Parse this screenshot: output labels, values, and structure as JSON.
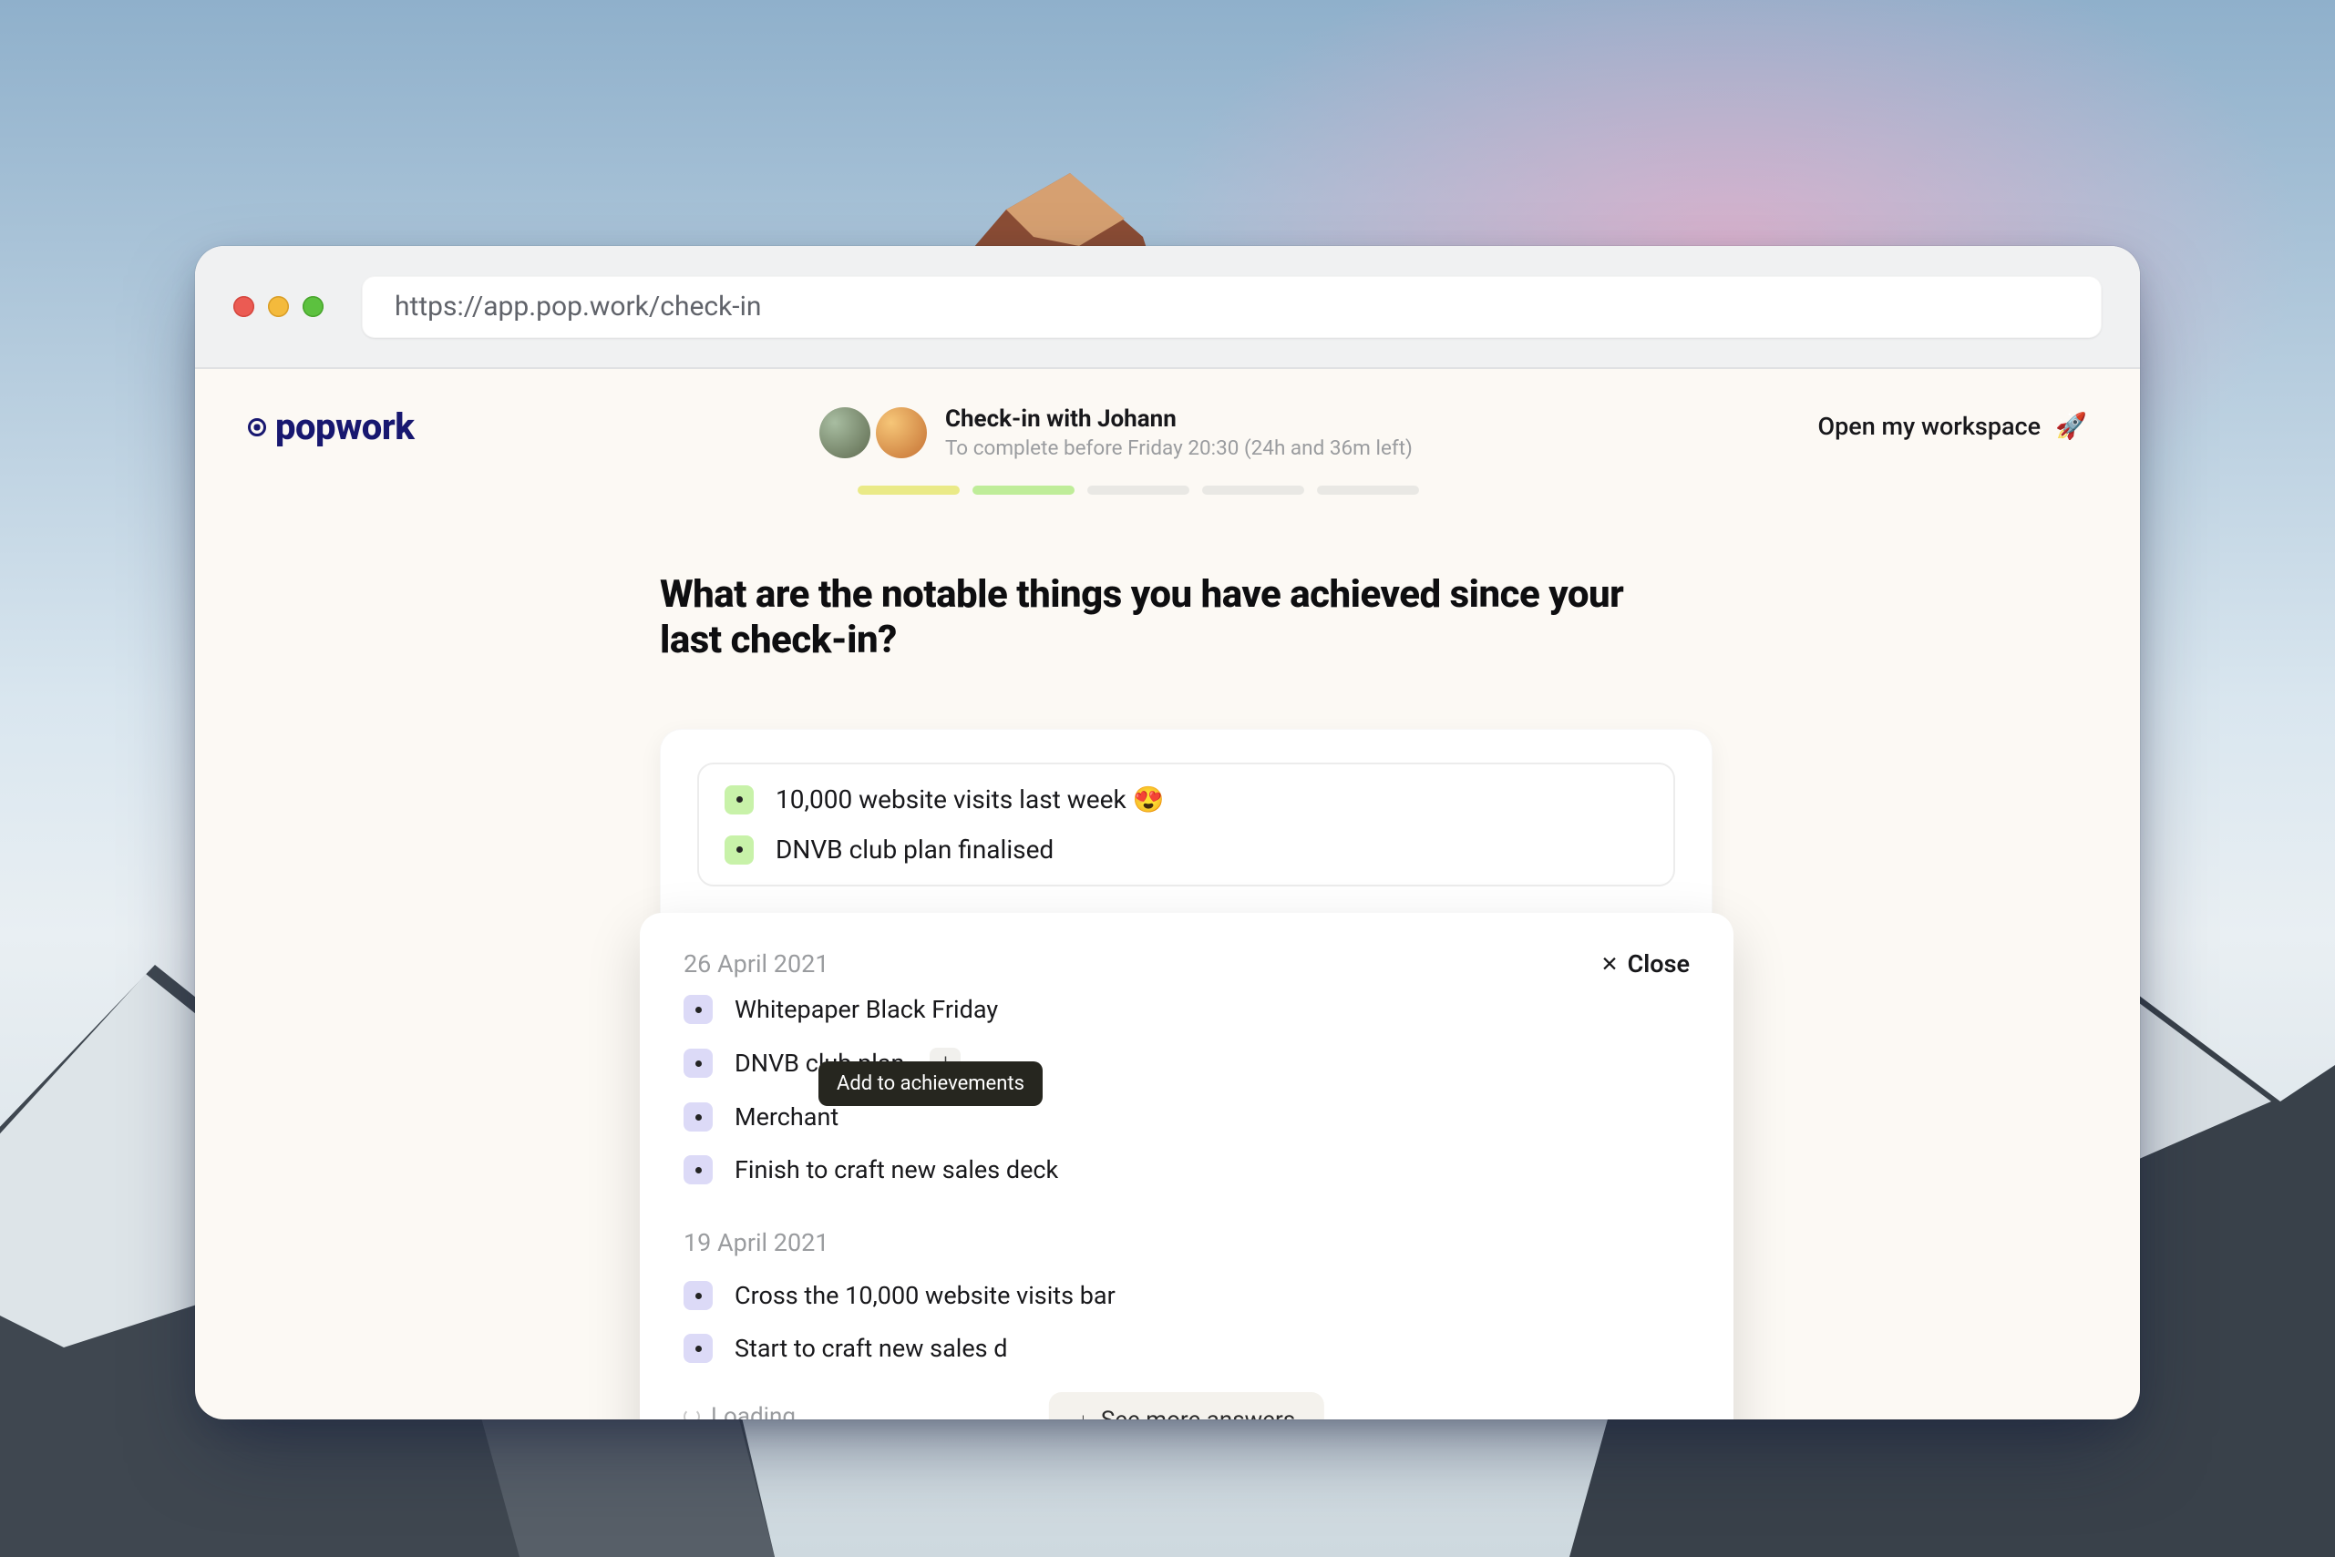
{
  "browser": {
    "url": "https://app.pop.work/check-in"
  },
  "header": {
    "logo": "popwork",
    "title": "Check-in with Johann",
    "deadline": "To complete before Friday 20:30 (24h and 36m left)",
    "workspace_link": "Open my workspace",
    "workspace_icon": "🚀"
  },
  "question": "What are the notable things you have achieved since your last check-in?",
  "current_answers": [
    "10,000 website visits last week 😍",
    "DNVB club plan finalised"
  ],
  "history": {
    "close_label": "Close",
    "tooltip": "Add to achievements",
    "see_more_label": "See more answers",
    "loading_label": "Loading...",
    "groups": [
      {
        "date": "26 April 2021",
        "items": [
          {
            "text": "Whitepaper Black Friday"
          },
          {
            "text": "DNVB club plan",
            "show_add": true
          },
          {
            "text": "Merchant"
          },
          {
            "text": "Finish to craft new sales deck"
          }
        ]
      },
      {
        "date": "19 April 2021",
        "items": [
          {
            "text": "Cross the 10,000 website visits bar"
          },
          {
            "text": "Start to craft new sales d"
          }
        ]
      }
    ]
  }
}
